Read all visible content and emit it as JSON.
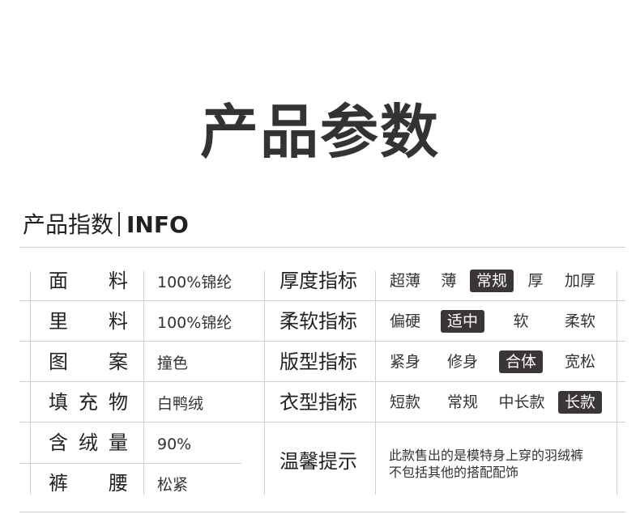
{
  "title": "产品参数",
  "section": {
    "title_cn": "产品指数",
    "title_en": "INFO"
  },
  "specs": [
    {
      "label": [
        "面",
        "料"
      ],
      "value": "100%锦纶"
    },
    {
      "label": [
        "里",
        "料"
      ],
      "value": "100%锦纶"
    },
    {
      "label": [
        "图",
        "案"
      ],
      "value": "撞色"
    },
    {
      "label": [
        "填",
        "充",
        "物"
      ],
      "value": "白鸭绒"
    },
    {
      "label": [
        "含",
        "绒",
        "量"
      ],
      "value": "90%"
    },
    {
      "label": [
        "裤",
        "腰"
      ],
      "value": "松紧"
    }
  ],
  "indices": [
    {
      "label": "厚度指标",
      "options": [
        "超薄",
        "薄",
        "常规",
        "厚",
        "加厚"
      ],
      "selected": "常规"
    },
    {
      "label": "柔软指标",
      "options": [
        "偏硬",
        "适中",
        "软",
        "柔软"
      ],
      "selected": "适中"
    },
    {
      "label": "版型指标",
      "options": [
        "紧身",
        "修身",
        "合体",
        "宽松"
      ],
      "selected": "合体"
    },
    {
      "label": "衣型指标",
      "options": [
        "短款",
        "常规",
        "中长款",
        "长款"
      ],
      "selected": "长款"
    }
  ],
  "tip": {
    "label": "温馨提示",
    "lines": [
      "此款售出的是模特身上穿的羽绒裤",
      "不包括其他的搭配配饰"
    ]
  },
  "colors": {
    "selected_bg": "#3a3536",
    "text": "#333333",
    "line": "#cfcfcf"
  }
}
